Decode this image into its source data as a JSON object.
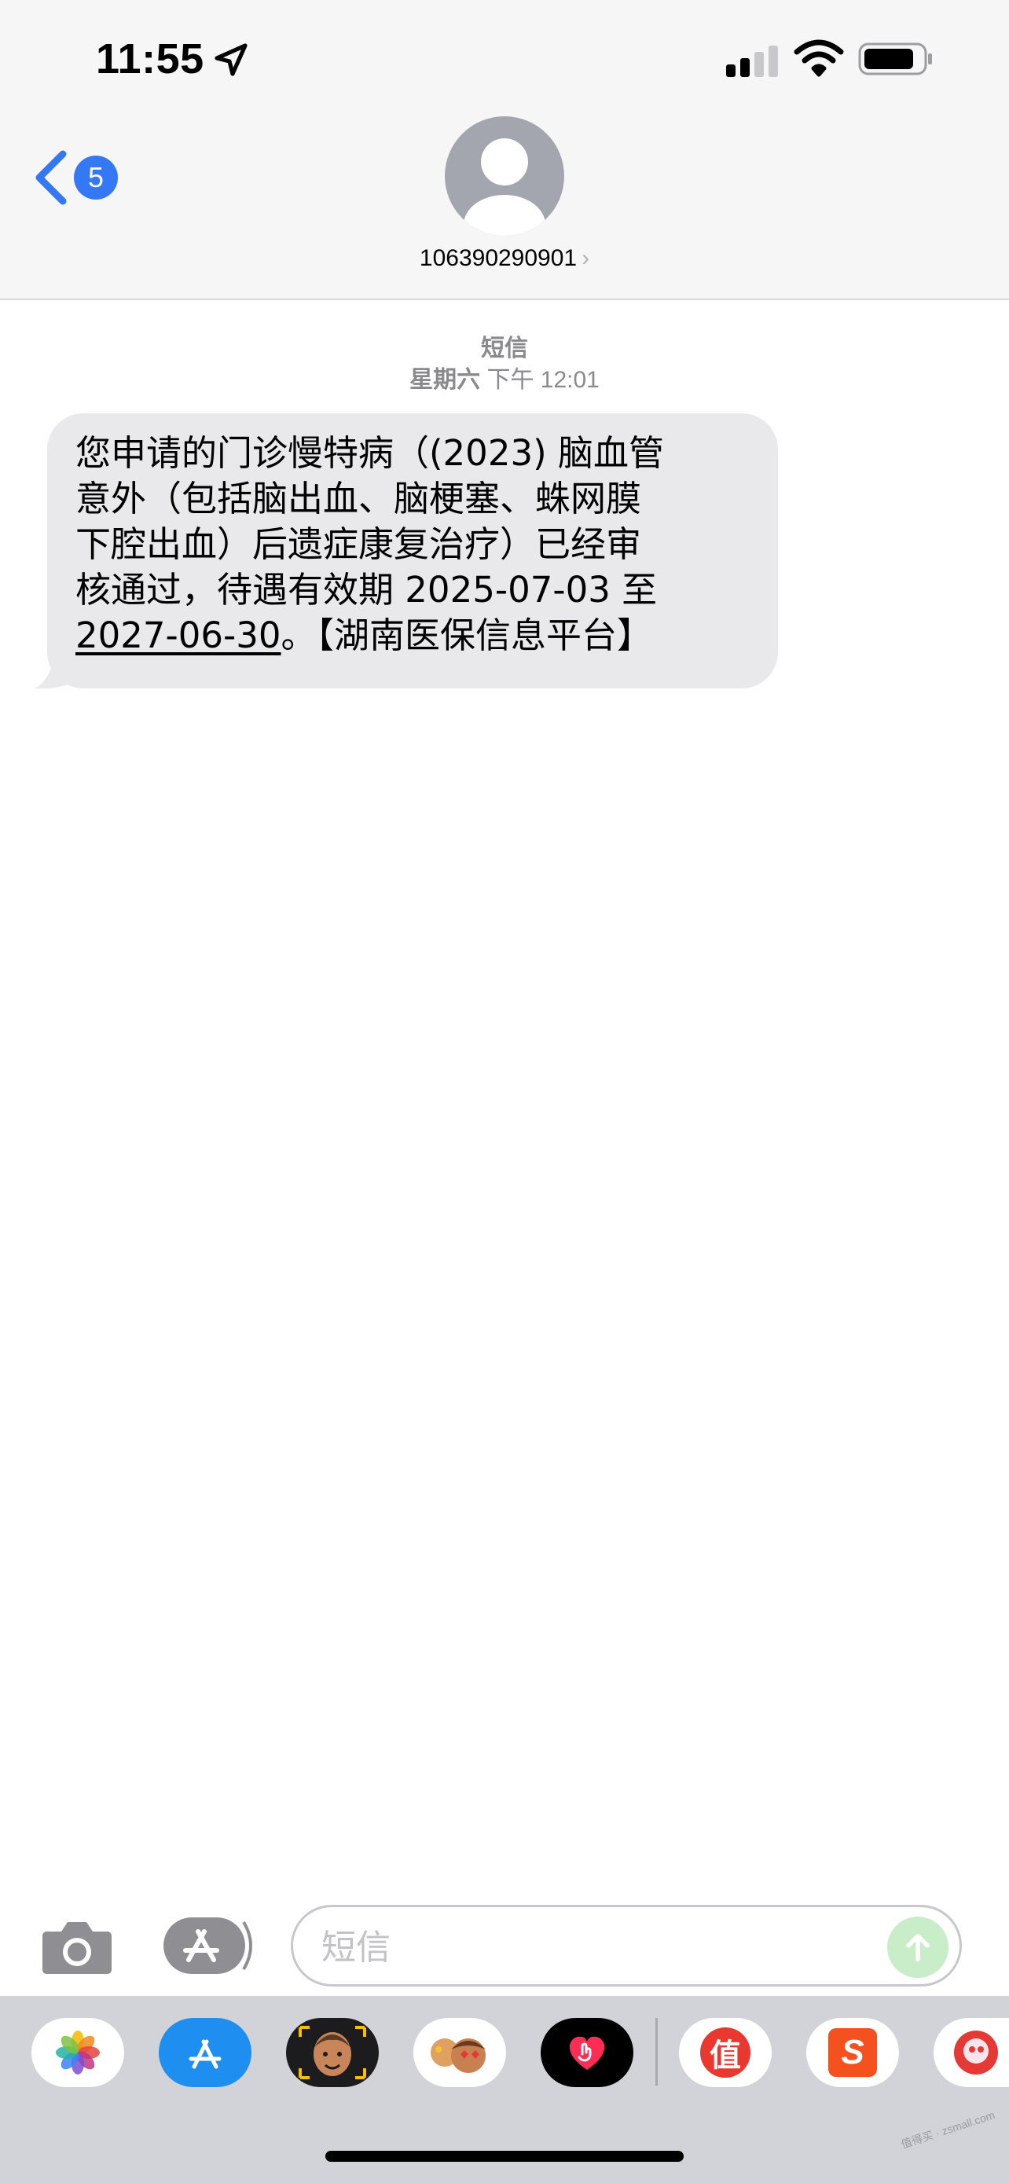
{
  "status_bar": {
    "time": "11:55"
  },
  "header": {
    "back_badge": "5",
    "contact": "106390290901",
    "contact_chevron": "›"
  },
  "conversation": {
    "service_label": "短信",
    "timestamp_day": "星期六",
    "timestamp_time": "下午 12:01",
    "message": {
      "line1": "您申请的门诊慢特病（(2023) 脑血管",
      "line2": "意外（包括脑出血、脑梗塞、蛛网膜",
      "line3": "下腔出血）后遗症康复治疗）已经审",
      "line4": "核通过，待遇有效期 2025-07-03 至",
      "line5_link": "2027-06-30",
      "line5_rest": "。【湖南医保信息平台】"
    }
  },
  "composer": {
    "placeholder": "短信"
  },
  "app_drawer": {
    "apps": [
      "photos-icon",
      "app-store-icon",
      "memoji-icon",
      "memoji-stickers-icon",
      "digital-touch-icon",
      "zhi-icon",
      "sogou-icon",
      "game-icon"
    ],
    "zhi_label": "值",
    "sogou_label": "S"
  },
  "colors": {
    "accent": "#3478f6",
    "bubble": "#e9e9eb",
    "header_bg": "#f6f6f6",
    "drawer_bg": "#d2d3d8"
  },
  "watermark": "值得买 · zsmall.com"
}
